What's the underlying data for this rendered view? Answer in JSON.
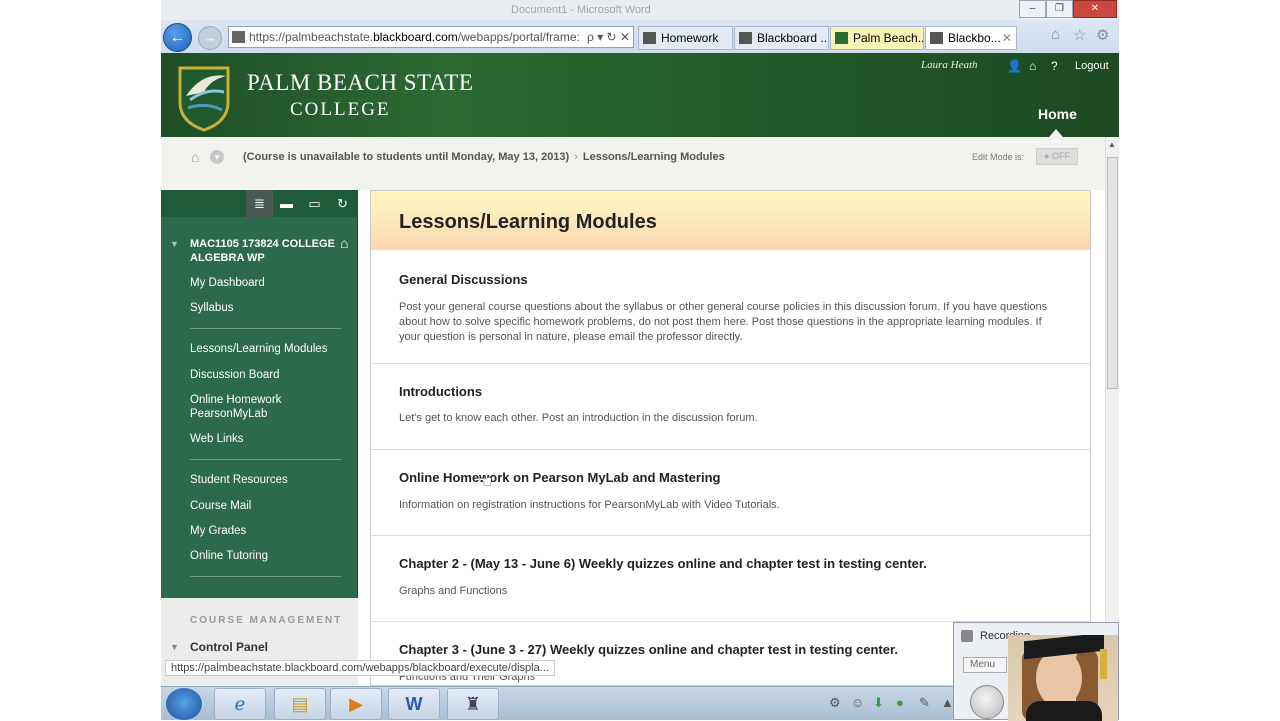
{
  "browser": {
    "window_title": "Document1 - Microsoft Word",
    "address_prefix": "https://palmbeachstate.",
    "address_domain": "blackboard.com",
    "address_suffix": "/webapps/portal/frame:",
    "address_icons": "ρ ▾ ↻ ✕",
    "tabs": [
      {
        "label": "Homework"
      },
      {
        "label": "Blackboard ..."
      },
      {
        "label": "Palm Beach..."
      },
      {
        "label": "Blackbo..."
      }
    ],
    "status_url": "https://palmbeachstate.blackboard.com/webapps/blackboard/execute/displa..."
  },
  "header": {
    "logo_line1": "PALM BEACH STATE",
    "logo_line2": "COLLEGE",
    "user_name": "Laura Heath",
    "logout": "Logout",
    "home_tab": "Home",
    "colors": {
      "primary_green": "#2c6a32",
      "menu_green": "#2d6a4d"
    }
  },
  "breadcrumb": {
    "course": "(Course is unavailable to students until Monday, May 13, 2013)",
    "separator": "›",
    "current": "Lessons/Learning Modules",
    "edit_mode_label": "Edit Mode is:",
    "edit_mode_value": "OFF"
  },
  "menu": {
    "course_title": "MAC1105 173824 COLLEGE ALGEBRA WP",
    "groups": [
      [
        "My Dashboard",
        "Syllabus"
      ],
      [
        "Lessons/Learning Modules",
        "Discussion Board",
        "Online Homework PearsonMyLab",
        "Web Links"
      ],
      [
        "Student Resources",
        "Course Mail",
        "My Grades",
        "Online Tutoring"
      ]
    ],
    "course_management": "COURSE MANAGEMENT",
    "control_panel": "Control Panel"
  },
  "content": {
    "title": "Lessons/Learning Modules",
    "items": [
      {
        "title": "General Discussions",
        "desc": "Post your general course questions about the syllabus or other general course policies in this discussion forum. If you have questions about how to solve specific homework problems, do not post them here. Post those questions in the appropriate learning modules. If your question is personal in nature, please email the professor directly."
      },
      {
        "title": "Introductions",
        "desc": "Let's get to know each other. Post an introduction in the discussion forum."
      },
      {
        "title": "Online Homework on Pearson MyLab and Mastering",
        "desc": "Information on registration instructions for PearsonMyLab with Video Tutorials."
      },
      {
        "title": "Chapter 2 - (May 13 - June 6) Weekly quizzes online and chapter test in testing center.",
        "desc": "Graphs and Functions"
      },
      {
        "title": "Chapter 3 - (June 3 - 27) Weekly quizzes online and chapter test in testing center.",
        "desc": "Functions and Their Graphs"
      }
    ]
  },
  "recorder": {
    "title": "Recording",
    "menu_label": "Menu"
  }
}
